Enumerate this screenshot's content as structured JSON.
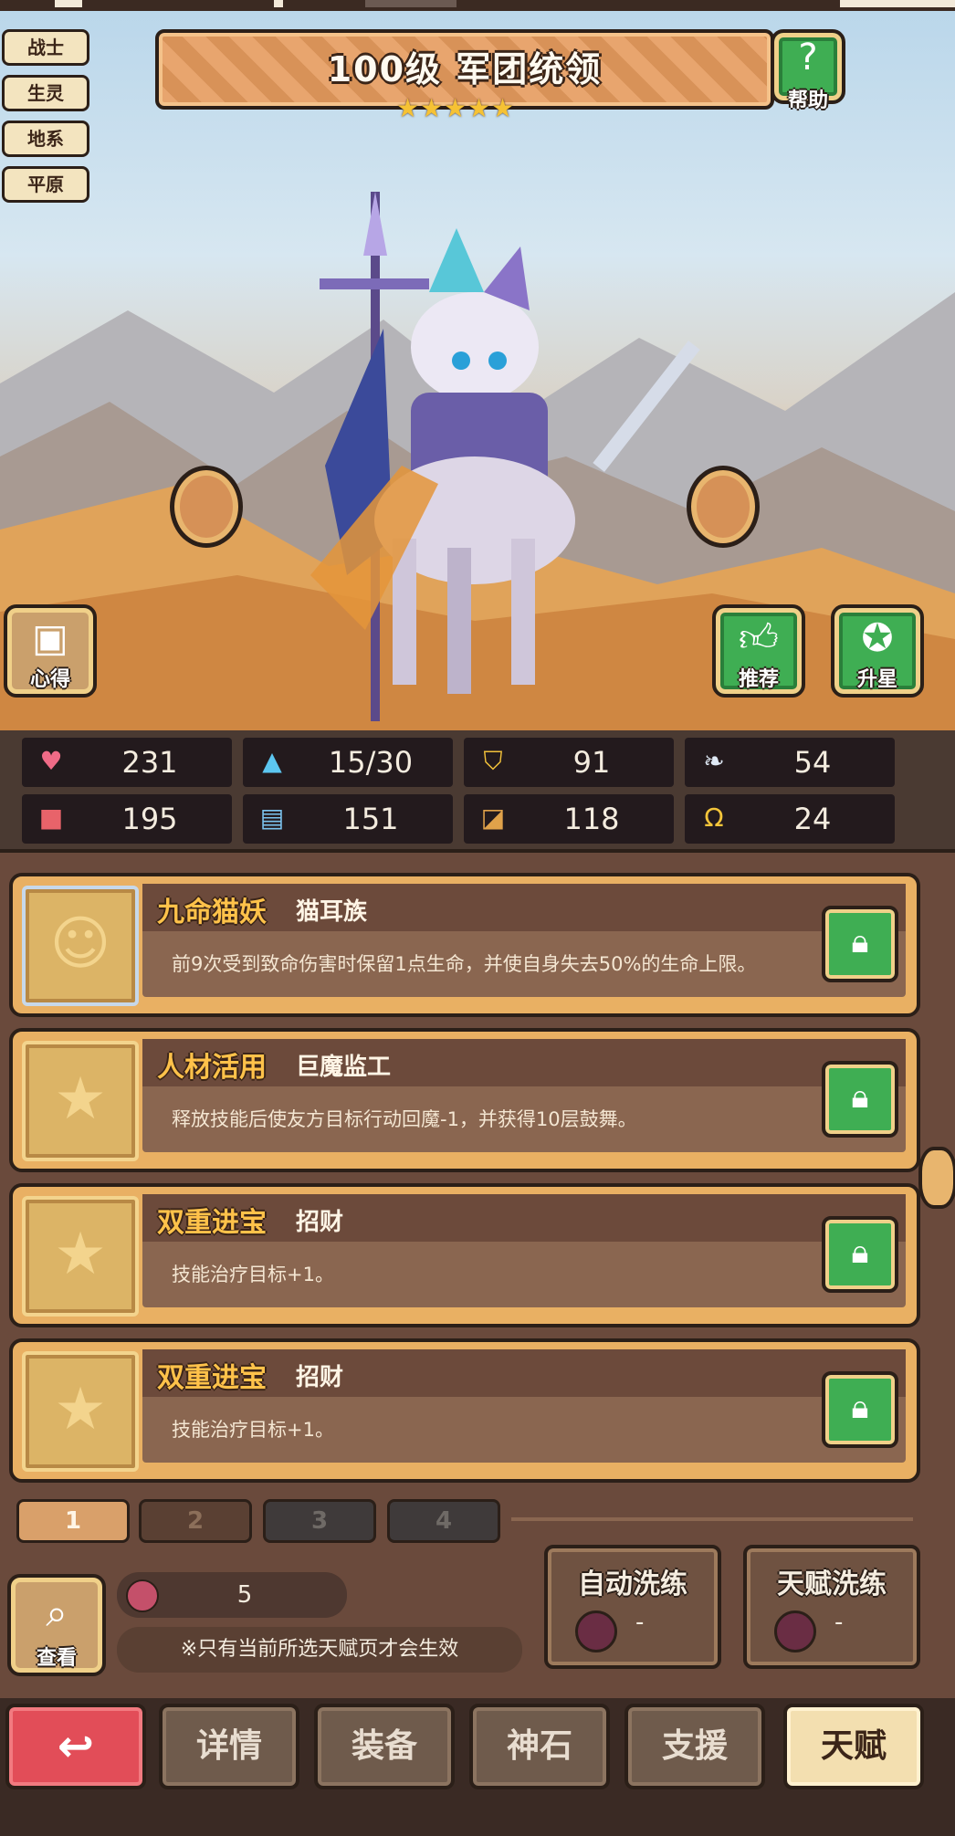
{
  "scene": {
    "class_tags": [
      "战士",
      "生灵",
      "地系",
      "平原"
    ],
    "title": "100级  军团统领",
    "star_count": 5,
    "help_label": "帮助",
    "notes_label": "心得",
    "recommend_label": "推荐",
    "upgrade_star_label": "升星"
  },
  "stats": [
    {
      "icon": "heart-icon",
      "value": "231",
      "color": "#f06b87"
    },
    {
      "icon": "water-drop-icon",
      "value": "15/30",
      "color": "#5cc6f0"
    },
    {
      "icon": "shield-icon",
      "value": "91",
      "color": "#f3c23a"
    },
    {
      "icon": "wing-icon",
      "value": "54",
      "color": "#dfe9f5"
    },
    {
      "icon": "fist-icon",
      "value": "195",
      "color": "#e8636a"
    },
    {
      "icon": "book-icon",
      "value": "151",
      "color": "#7cc4ef"
    },
    {
      "icon": "boot-icon",
      "value": "118",
      "color": "#e0a24a"
    },
    {
      "icon": "horseshoe-icon",
      "value": "24",
      "color": "#f4c53a"
    }
  ],
  "talents": [
    {
      "name": "九命猫妖",
      "source": "猫耳族",
      "desc": "前9次受到致命伤害时保留1点生命，并使自身失去50%的生命上限。",
      "icon": "cat-face-icon"
    },
    {
      "name": "人材活用",
      "source": "巨魔监工",
      "desc": "释放技能后使友方目标行动回魔-1，并获得10层鼓舞。",
      "icon": "star-icon"
    },
    {
      "name": "双重进宝",
      "source": "招财",
      "desc": "技能治疗目标+1。",
      "icon": "star-icon"
    },
    {
      "name": "双重进宝",
      "source": "招财",
      "desc": "技能治疗目标+1。",
      "icon": "star-icon"
    }
  ],
  "page_tabs": [
    "1",
    "2",
    "3",
    "4"
  ],
  "active_page": "1",
  "bottom": {
    "view_label": "查看",
    "resource_count": "5",
    "note": "※只有当前所选天赋页才会生效",
    "auto_reset_label": "自动洗练",
    "auto_reset_cost": "-",
    "talent_reset_label": "天赋洗练",
    "talent_reset_cost": "-"
  },
  "nav": {
    "details": "详情",
    "equipment": "装备",
    "godstone": "神石",
    "support": "支援",
    "talent": "天赋"
  }
}
